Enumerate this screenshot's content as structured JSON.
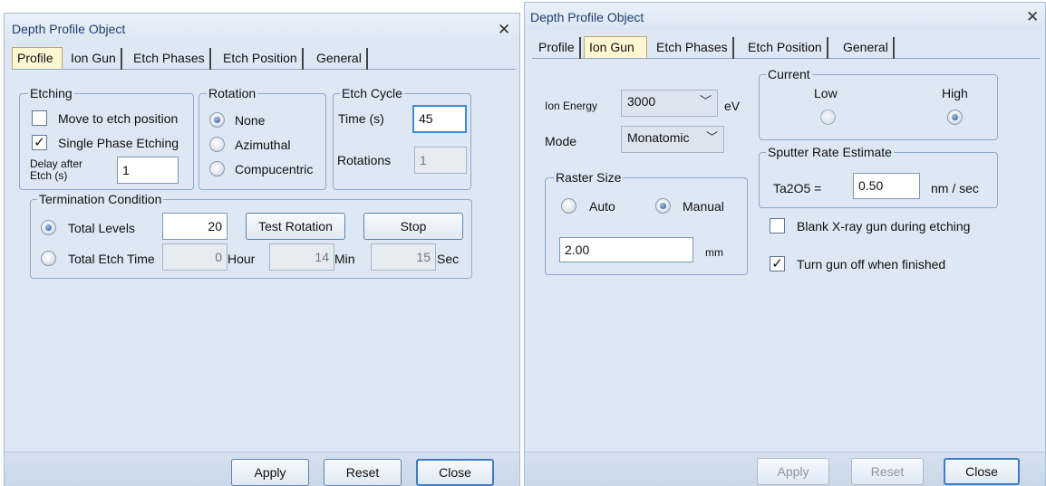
{
  "left": {
    "title": "Depth Profile Object",
    "tabs": [
      "Profile",
      "Ion Gun",
      "Etch Phases",
      "Etch Position",
      "General"
    ],
    "etching": {
      "legend": "Etching",
      "move_label": "Move to etch position",
      "single_phase_label": "Single Phase Etching",
      "delay_label": "Delay after Etch (s)",
      "delay_value": "1"
    },
    "rotation": {
      "legend": "Rotation",
      "options": [
        "None",
        "Azimuthal",
        "Compucentric"
      ]
    },
    "etch_cycle": {
      "legend": "Etch Cycle",
      "time_label": "Time (s)",
      "time_value": "45",
      "rotations_label": "Rotations",
      "rotations_value": "1"
    },
    "termination": {
      "legend": "Termination Condition",
      "total_levels_label": "Total Levels",
      "total_levels_value": "20",
      "test_rotation_label": "Test Rotation",
      "stop_label": "Stop",
      "total_etch_time_label": "Total Etch Time",
      "hour_value": "0",
      "hour_unit": "Hour",
      "min_value": "14",
      "min_unit": "Min",
      "sec_value": "15",
      "sec_unit": "Sec"
    },
    "buttons": {
      "apply": "Apply",
      "reset": "Reset",
      "close": "Close"
    }
  },
  "right": {
    "title": "Depth Profile Object",
    "tabs": [
      "Profile",
      "Ion Gun",
      "Etch Phases",
      "Etch Position",
      "General"
    ],
    "ion_energy_label": "Ion Energy",
    "ion_energy_value": "3000",
    "ion_energy_unit": "eV",
    "mode_label": "Mode",
    "mode_value": "Monatomic",
    "current": {
      "legend": "Current",
      "low_label": "Low",
      "high_label": "High"
    },
    "sputter": {
      "legend": "Sputter Rate Estimate",
      "label": "Ta2O5 =",
      "value": "0.50",
      "unit": "nm / sec"
    },
    "raster": {
      "legend": "Raster Size",
      "auto_label": "Auto",
      "manual_label": "Manual",
      "value": "2.00",
      "unit": "mm"
    },
    "blank_xray_label": "Blank X-ray gun during etching",
    "turn_off_label": "Turn gun off when finished",
    "buttons": {
      "apply": "Apply",
      "reset": "Reset",
      "close": "Close"
    }
  },
  "colors": {
    "window_bg": "#dde8f4",
    "title_text": "#1e3f6e",
    "active_tab": "#fff7d2",
    "group_border": "#8fa9cd",
    "focus_border": "#3d8ad8"
  }
}
